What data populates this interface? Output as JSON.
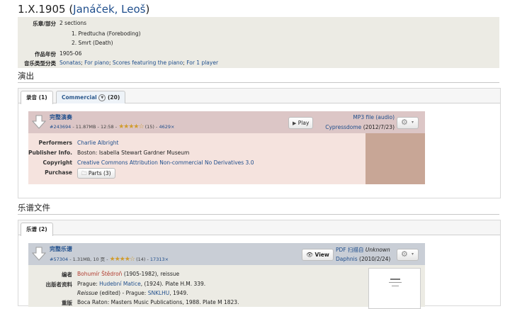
{
  "header": {
    "work_number": "1.X.1905",
    "composer_link": "Janáček, Leoš"
  },
  "info": {
    "movements_label": "乐章/部分",
    "movements_count": "2 sections",
    "movements": [
      "1. Predtucha (Foreboding)",
      "2. Smrt (Death)"
    ],
    "year_label": "作品年份",
    "year_value": "1905-06",
    "category_label": "音乐类型分类",
    "categories": [
      "Sonatas",
      "For piano",
      "Scores featuring the piano",
      "For 1 player"
    ]
  },
  "performances": {
    "heading": "演出",
    "tabs": [
      {
        "label": "录音 (1)"
      },
      {
        "label": "Commercial",
        "count": "(20)"
      }
    ],
    "recording": {
      "title": "完整演奏",
      "id": "#243694",
      "size": "11.87MB",
      "duration": "12:58",
      "rating_count": "(15)",
      "downloads": "4629×",
      "rating": 3.5,
      "play_label": "Play",
      "file_type": "MP3 file (audio)",
      "uploader": "Cypressdome",
      "date": "(2012/7/23)",
      "performers_label": "Performers",
      "performers": "Charlie Albright",
      "publisher_label": "Publisher Info.",
      "publisher": "Boston: Isabella Stewart Gardner Museum",
      "copyright_label": "Copyright",
      "copyright": "Creative Commons Attribution Non-commercial No Derivatives 3.0",
      "purchase_label": "Purchase",
      "parts_label": "Parts (3)"
    }
  },
  "scores": {
    "heading": "乐谱文件",
    "tabs": [
      {
        "label": "乐谱 (2)"
      }
    ],
    "score": {
      "title": "完整乐谱",
      "id": "#57304",
      "size": "1.31MB",
      "pages": "10 页",
      "rating_count": "(14)",
      "downloads": "17313×",
      "rating": 3.5,
      "view_label": "View",
      "file_type_pre": "PDF 扫描自",
      "file_type_source": "Unknown",
      "uploader": "Daphnis",
      "date": "(2010/2/24)",
      "editor_label": "编者",
      "editor_name": "Bohumír Štědroň",
      "editor_rest": "(1905-1982), reissue",
      "publisher_label": "出版者资料",
      "publisher_line1_pre": "Prague: ",
      "publisher_line1_link": "Hudební Matice",
      "publisher_line1_post": ", (1924). Plate H.M. 339.",
      "publisher_line2_italic": "Reissue",
      "publisher_line2_mid": " (edited) - Prague: ",
      "publisher_line2_link": "SNKLHU",
      "publisher_line2_post": ", 1949.",
      "reprint_label": "重版",
      "reprint_value": "Boca Raton: Masters Music Publications, 1988. Plate M 1823."
    }
  },
  "colors": {
    "recording_header": "#dcc6c6",
    "recording_body": "#f5e3de",
    "recording_thumb": "#c8a696",
    "score_header": "#c9ced6",
    "score_body": "#ecebe4",
    "link": "#1f4e8c",
    "editor_link": "#b03a2e"
  }
}
